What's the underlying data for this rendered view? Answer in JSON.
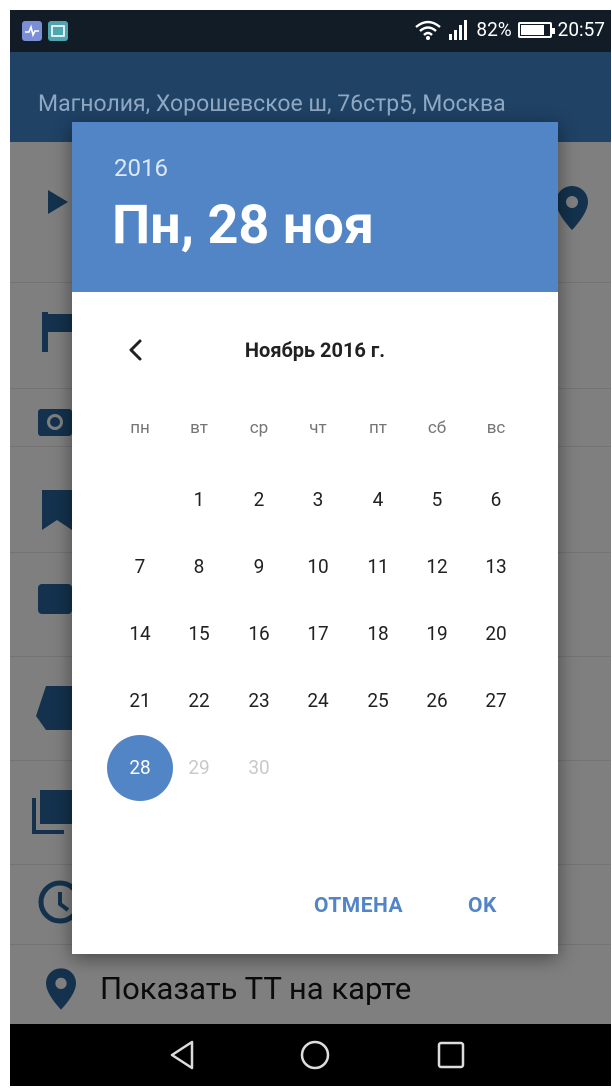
{
  "status_bar": {
    "battery_percent": "82%",
    "time": "20:57",
    "battery_level": 0.82,
    "icons": [
      "health-app-notification-icon",
      "gallery-notification-icon",
      "wifi-icon",
      "signal-icon",
      "battery-icon"
    ]
  },
  "app_bar": {
    "title": "Магнолия, Хорошевское ш, 76стр5, Москва"
  },
  "background_list": {
    "last_item_label": "Показать ТТ на карте",
    "icons": [
      "play-icon",
      "flag-icon",
      "camera-icon",
      "bookmark-icon",
      "card-icon",
      "tags-icon",
      "photo-library-icon",
      "clock-icon",
      "location-pin-icon"
    ]
  },
  "date_picker": {
    "header_year": "2016",
    "header_date": "Пн, 28 ноя",
    "month_label": "Ноябрь 2016 г.",
    "weekdays": [
      "пн",
      "вт",
      "ср",
      "чт",
      "пт",
      "сб",
      "вс"
    ],
    "days": [
      "1",
      "2",
      "3",
      "4",
      "5",
      "6",
      "7",
      "8",
      "9",
      "10",
      "11",
      "12",
      "13",
      "14",
      "15",
      "16",
      "17",
      "18",
      "19",
      "20",
      "21",
      "22",
      "23",
      "24",
      "25",
      "26",
      "27",
      "28",
      "29",
      "30"
    ],
    "first_weekday_index": 1,
    "selected_day": "28",
    "disabled_days": [
      "29",
      "30"
    ],
    "cancel_label": "ОТМЕНА",
    "ok_label": "OK"
  },
  "nav_bar": {
    "icons": [
      "back-icon",
      "home-icon",
      "recents-icon"
    ]
  },
  "colors": {
    "accent": "#5185c6",
    "app_bar": "#1f4265",
    "status_bar": "#111c26",
    "scrim_background": "#7f7f7f"
  }
}
